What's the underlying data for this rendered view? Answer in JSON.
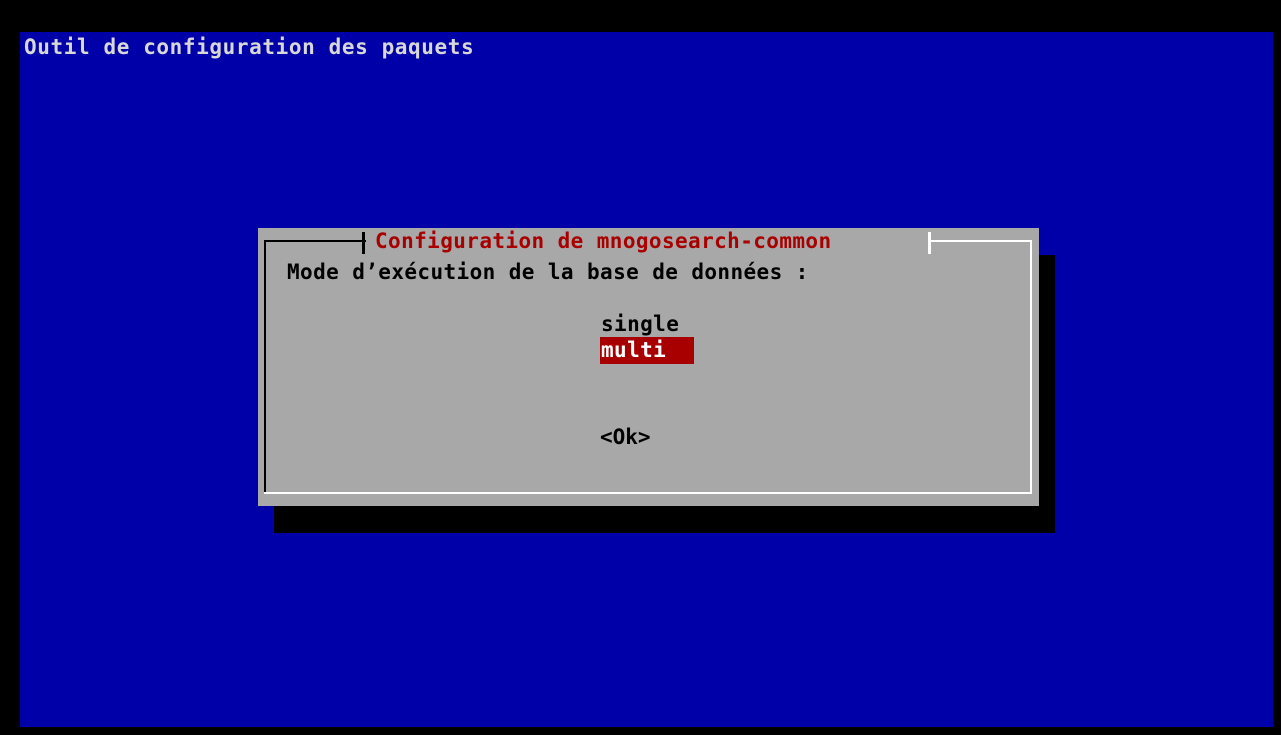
{
  "backtitle": "Outil de configuration des paquets",
  "dialog": {
    "title": "Configuration de mnogosearch-common",
    "prompt": "Mode d’exécution de la base de données :",
    "options": [
      {
        "label": "single",
        "selected": false
      },
      {
        "label": "multi",
        "selected": true
      }
    ],
    "ok_label": "<Ok>"
  },
  "colors": {
    "background": "#0000a8",
    "dialog": "#a8a8a8",
    "accent": "#a80000",
    "shadow": "#000000",
    "title_text": "#a80000",
    "backtitle_text": "#d8d8d8"
  }
}
